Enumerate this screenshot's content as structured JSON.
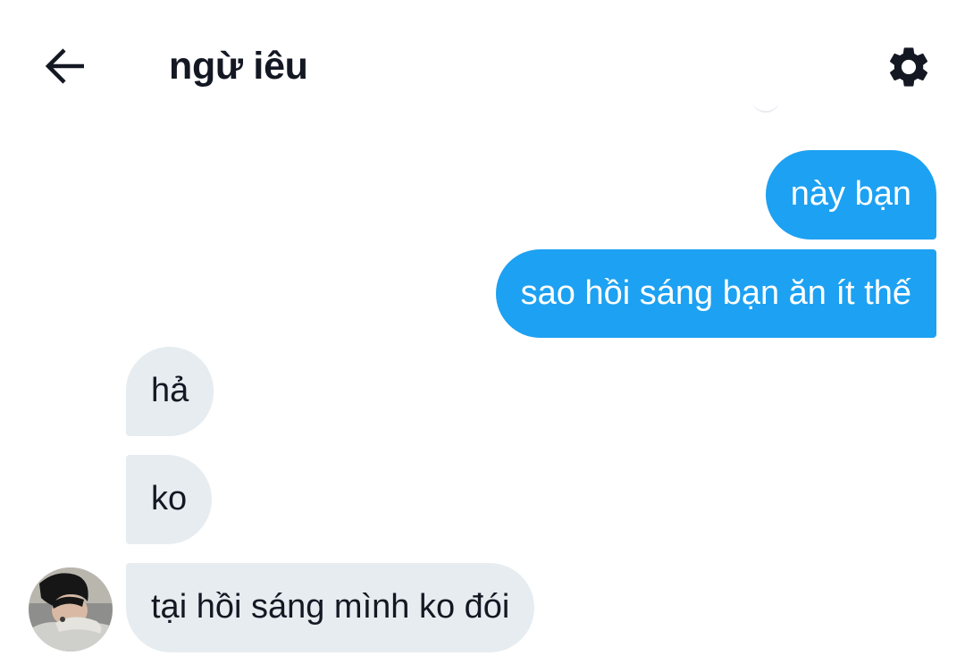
{
  "header": {
    "title": "ngừ iêu",
    "back_icon": "arrow-left-icon",
    "settings_icon": "gear-icon"
  },
  "messages": [
    {
      "direction": "outgoing",
      "text": "này bạn"
    },
    {
      "direction": "outgoing",
      "text": "sao hồi sáng bạn ăn ít thế"
    },
    {
      "direction": "incoming",
      "text": "hả"
    },
    {
      "direction": "incoming",
      "text": "ko"
    },
    {
      "direction": "incoming",
      "text": "tại hồi sáng mình ko đói"
    }
  ],
  "colors": {
    "outgoing_bubble": "#1da1f2",
    "incoming_bubble": "#e6ecf0",
    "text_dark": "#141823",
    "text_light": "#ffffff"
  }
}
